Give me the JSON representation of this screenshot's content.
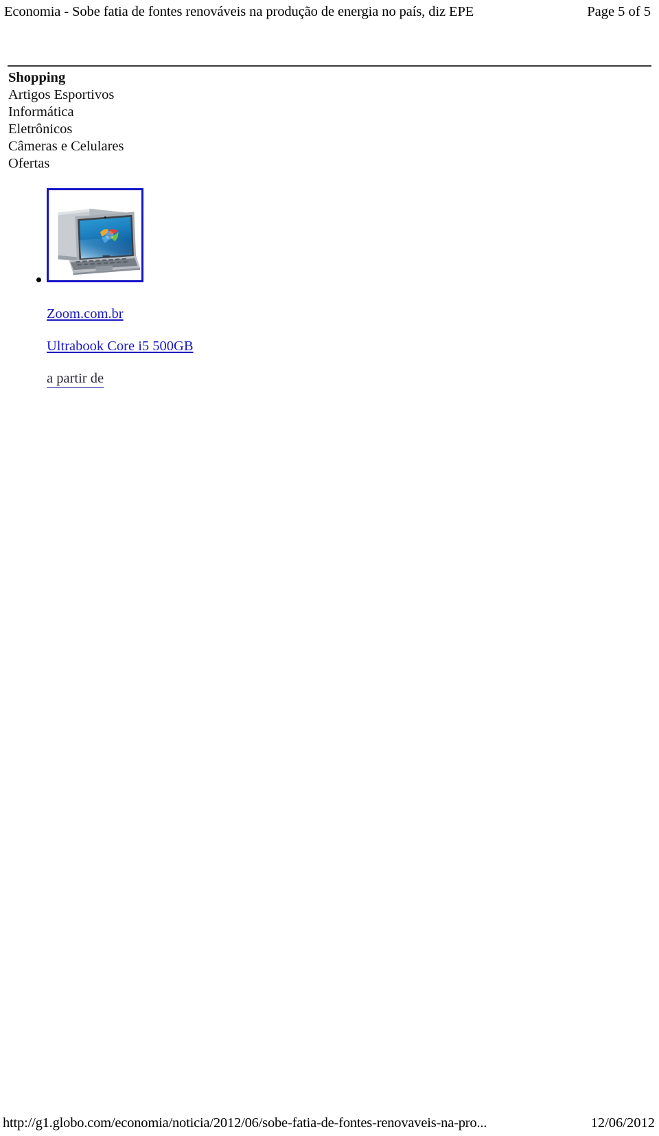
{
  "header": {
    "doc_title": "Economia - Sobe fatia de fontes renováveis na produção de energia no país, diz EPE",
    "page_indicator": "Page 5 of 5"
  },
  "shopping_widget": {
    "heading": "Shopping",
    "nav_items": [
      {
        "label": "Artigos Esportivos"
      },
      {
        "label": "Informática"
      },
      {
        "label": "Eletrônicos"
      },
      {
        "label": "Câmeras e Celulares"
      },
      {
        "label": "Ofertas"
      }
    ]
  },
  "product": {
    "thumbnail_alt": "ultrabook-laptop-thumbnail",
    "merchant_link": "Zoom.com.br",
    "title_link": "Ultrabook Core i5 500GB",
    "price_prefix": "a partir de"
  },
  "footer": {
    "url": "http://g1.globo.com/economia/noticia/2012/06/sobe-fatia-de-fontes-renovaveis-na-pro...",
    "date": "12/06/2012"
  },
  "colors": {
    "link_blue": "#1a1ac0",
    "thumb_border_blue": "#1414c8",
    "rule_gray": "#3a3a3a",
    "text_black": "#111111"
  }
}
